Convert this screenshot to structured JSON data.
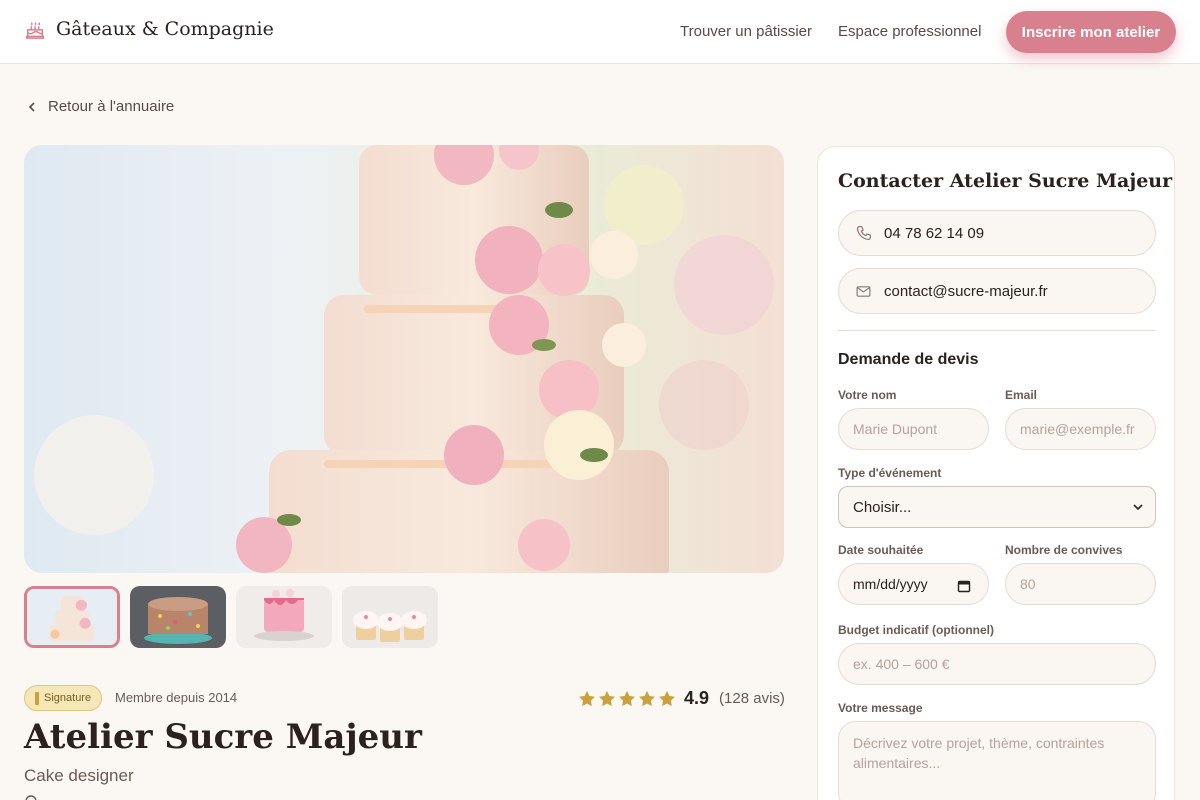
{
  "header": {
    "brand": "Gâteaux & Compagnie",
    "nav": [
      "Trouver un pâtissier",
      "Espace professionnel"
    ],
    "cta": "Inscrire mon atelier"
  },
  "back_link": "Retour à l'annuaire",
  "gallery": {
    "thumbnails": [
      "tiered-floral-cake",
      "sprinkle-layer-cake",
      "pink-drip-cake",
      "cupcakes"
    ],
    "active_index": 0
  },
  "profile": {
    "badge": "Signature",
    "member_since": "Membre depuis 2014",
    "rating_value": "4.9",
    "rating_count": "(128 avis)",
    "stars": 5,
    "name": "Atelier Sucre Majeur",
    "category": "Cake designer"
  },
  "contact": {
    "title": "Contacter Atelier Sucre Majeur",
    "phone": "04 78 62 14 09",
    "email": "contact@sucre-majeur.fr"
  },
  "quote_form": {
    "title": "Demande de devis",
    "name_label": "Votre nom",
    "name_placeholder": "Marie Dupont",
    "email_label": "Email",
    "email_placeholder": "marie@exemple.fr",
    "event_label": "Type d'événement",
    "event_selected": "Choisir...",
    "date_label": "Date souhaitée",
    "date_placeholder": "mm/dd/yyyy",
    "guests_label": "Nombre de convives",
    "guests_placeholder": "80",
    "budget_label": "Budget indicatif (optionnel)",
    "budget_placeholder": "ex. 400 – 600 €",
    "message_label": "Votre message",
    "message_placeholder": "Décrivez votre projet, thème, contraintes alimentaires..."
  },
  "colors": {
    "accent": "#d9808e",
    "background": "#fbf8f4",
    "star": "#c9a23e"
  }
}
